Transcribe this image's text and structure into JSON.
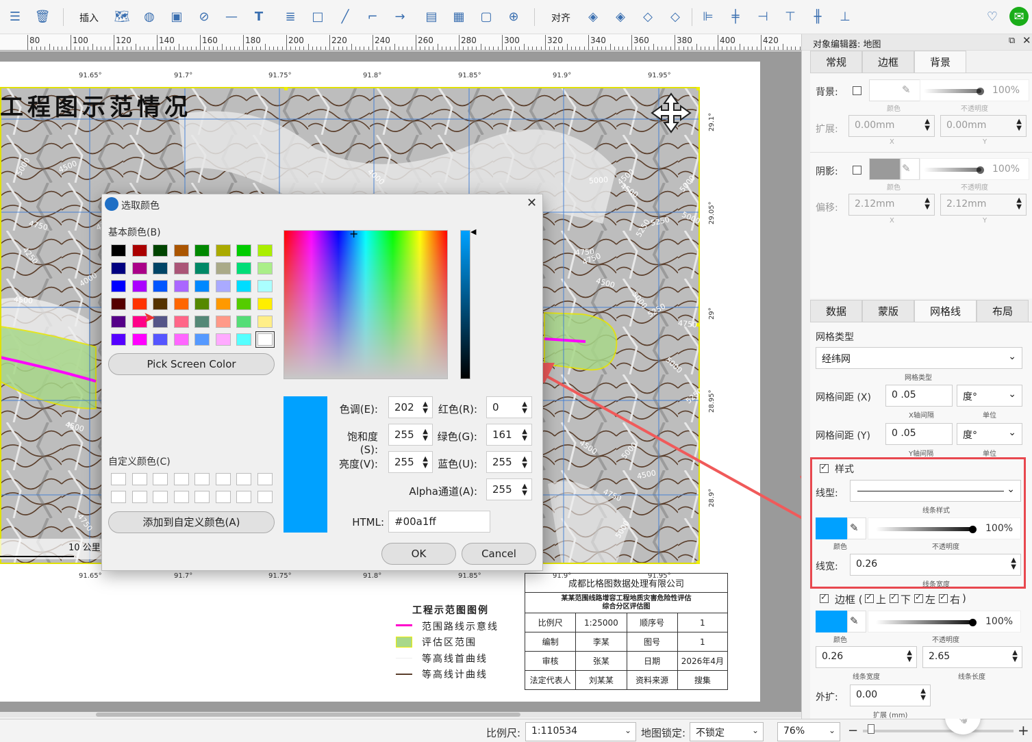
{
  "toolbar": {
    "insert_label": "插入",
    "align_label": "对齐",
    "icons": [
      "list-icon",
      "trash-icon",
      "map-icon",
      "globe-icon",
      "image-icon",
      "compass-icon",
      "line-icon",
      "text-icon",
      "list-bullet-icon",
      "rectangle-icon",
      "segment-icon",
      "polyline-icon",
      "arrow-icon",
      "comment-icon",
      "table-icon",
      "frame-icon",
      "web-icon",
      "layer-up-icon",
      "layer-top-icon",
      "layer-down-icon",
      "layer-bottom-icon",
      "align-left-icon",
      "align-center-icon",
      "align-right-icon",
      "align-top-icon",
      "align-middle-icon",
      "align-bottom-icon"
    ]
  },
  "ruler": {
    "labels": [
      "80",
      "100",
      "120",
      "140",
      "160",
      "180",
      "200",
      "220",
      "240",
      "260",
      "280",
      "300",
      "320",
      "340",
      "360",
      "380",
      "400",
      "420"
    ]
  },
  "map": {
    "title": "工程图示范情况",
    "lon_labels": [
      "91.65°",
      "91.7°",
      "91.75°",
      "91.8°",
      "91.85°",
      "91.9°",
      "91.95°"
    ],
    "lat_labels": [
      "29.1°",
      "29.05°",
      "29°",
      "28.95°",
      "28.9°"
    ],
    "contours": [
      "5000",
      "4500",
      "4750",
      "4250",
      "4000",
      "4500",
      "4000",
      "4500",
      "5000",
      "4500",
      "5000",
      "5250",
      "5000",
      "5250",
      "4750",
      "4500",
      "5000",
      "5250",
      "4750",
      "5000",
      "5250",
      "4750",
      "4500",
      "5000",
      "4500",
      "4750",
      "5000",
      "4750",
      "4500",
      "4750"
    ],
    "scale_label": "10 公里"
  },
  "legend": {
    "title": "工程示范图图例",
    "items": [
      "范围路线示意线",
      "评估区范围",
      "等高线首曲线",
      "等高线计曲线"
    ]
  },
  "titleblock": {
    "company": "成都比格图数据处理有限公司",
    "project_line1": "某某范围线路增容工程地质灾害危险性评估",
    "project_line2": "综合分区评估图",
    "rows": [
      [
        "比例尺",
        "1:25000",
        "顺序号",
        "1"
      ],
      [
        "编制",
        "李某",
        "图号",
        "1"
      ],
      [
        "审核",
        "张某",
        "日期",
        "2026年4月"
      ],
      [
        "法定代表人",
        "刘某某",
        "资料来源",
        "搜集"
      ]
    ]
  },
  "status": {
    "scale_label": "比例尺:",
    "scale_value": "1:110534",
    "lock_label": "地图锁定:",
    "lock_value": "不锁定",
    "zoom_value": "76%",
    "zoom_minus": "−",
    "zoom_plus": "+"
  },
  "panel": {
    "title": "对象编辑器: 地图",
    "top_tabs": [
      "常规",
      "边框",
      "背景"
    ],
    "bg": {
      "bg_label": "背景:",
      "color_caption": "颜色",
      "opacity_caption": "不透明度",
      "opacity": "100%",
      "expand_label": "扩展:",
      "expand_x": "0.00mm",
      "expand_y": "0.00mm",
      "x_caption": "X",
      "y_caption": "Y",
      "shadow_label": "阴影:",
      "shadow_opacity": "100%",
      "offset_label": "偏移:",
      "offset_x": "2.12mm",
      "offset_y": "2.12mm"
    },
    "bottom_tabs": [
      "数据",
      "蒙版",
      "网格线",
      "布局"
    ],
    "grid": {
      "type_label": "网格类型",
      "type_value": "经纬网",
      "type_caption": "网格类型",
      "x_label": "网格间距 (X)",
      "x_value": "0 .05",
      "x_caption": "X轴间隔",
      "x_unit": "度°",
      "unit_caption": "单位",
      "y_label": "网格间距 (Y)",
      "y_value": "0 .05",
      "y_caption": "Y轴间隔",
      "y_unit": "度°"
    },
    "style": {
      "section": "样式",
      "linetype_label": "线型:",
      "linetype_caption": "线条样式",
      "color_caption": "颜色",
      "opacity": "100%",
      "opacity_caption": "不透明度",
      "width_label": "线宽:",
      "width_value": "0.26",
      "width_caption": "线条宽度",
      "color": "#00a1ff"
    },
    "border": {
      "section": "边框 (",
      "sides": [
        "上",
        "下",
        "左",
        "右"
      ],
      "close": ")",
      "color_caption": "颜色",
      "opacity": "100%",
      "opacity_caption": "不透明度",
      "width_value": "0.26",
      "width_caption": "线条宽度",
      "length_value": "2.65",
      "length_caption": "线条长度",
      "expand_label": "外扩:",
      "expand_value": "0.00",
      "expand_caption": "扩展 (mm)"
    }
  },
  "dialog": {
    "title": "选取颜色",
    "basic_label": "基本颜色(B)",
    "basic_colors": [
      "#000000",
      "#aa0000",
      "#004400",
      "#aa5500",
      "#008800",
      "#aaaa00",
      "#00cc00",
      "#aaee00",
      "#000080",
      "#aa0088",
      "#004466",
      "#aa5577",
      "#008866",
      "#aaaa88",
      "#00dd77",
      "#aaee88",
      "#0000ff",
      "#aa00ff",
      "#0055ff",
      "#aa66ff",
      "#0088ff",
      "#aaaaff",
      "#00ddff",
      "#aaffff",
      "#550000",
      "#ff3300",
      "#553300",
      "#ff6600",
      "#558800",
      "#ff9900",
      "#55cc00",
      "#ffee00",
      "#550088",
      "#ff0088",
      "#555588",
      "#ff6688",
      "#558877",
      "#ff9988",
      "#55dd77",
      "#ffee88",
      "#5500ff",
      "#ff00ff",
      "#5555ff",
      "#ff66ff",
      "#5599ff",
      "#ffaaff",
      "#55ffff",
      "#ffffff"
    ],
    "pick_screen": "Pick Screen Color",
    "custom_label": "自定义颜色(C)",
    "add_custom": "添加到自定义颜色(A)",
    "hue_label": "色调(E):",
    "hue": "202",
    "sat_label": "饱和度(S):",
    "sat": "255",
    "val_label": "亮度(V):",
    "val": "255",
    "red_label": "红色(R):",
    "red": "0",
    "green_label": "绿色(G):",
    "green": "161",
    "blue_label": "蓝色(U):",
    "blue": "255",
    "alpha_label": "Alpha通道(A):",
    "alpha": "255",
    "html_label": "HTML:",
    "html": "#00a1ff",
    "ok": "OK",
    "cancel": "Cancel",
    "current_color": "#00a1ff"
  }
}
